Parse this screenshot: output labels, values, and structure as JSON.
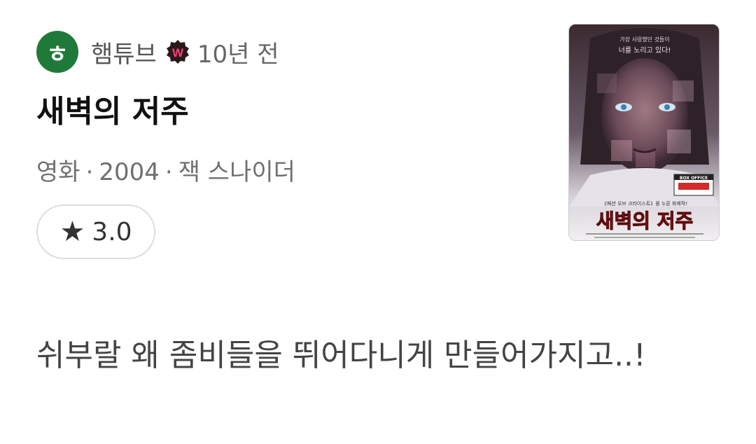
{
  "author": {
    "name": "햄튜브",
    "avatar_letter": "ㅎ",
    "badge_letter": "W",
    "time_ago": "10년 전"
  },
  "movie": {
    "title": "새벽의 저주",
    "category": "영화",
    "year": "2004",
    "director": "잭 스나이더",
    "separator": "·"
  },
  "rating": {
    "icon": "star-icon",
    "value": "3.0"
  },
  "poster": {
    "tagline_line1": "가장 사랑했던 것들이",
    "tagline_line2": "너를 노리고 있다!",
    "box_office": "BOX OFFICE",
    "promo": "《패션 오브 크라이스트》를 누른 화제작!",
    "title_text": "새벽의 저주"
  },
  "review": {
    "text": "쉬부랄 왜 좀비들을 뛰어다니게 만들어가지고..!"
  },
  "colors": {
    "avatar_bg": "#1f7a3a",
    "badge_bg": "#2a1a1a",
    "badge_letter": "#ff3d7f",
    "poster_title": "#d42a2a"
  }
}
